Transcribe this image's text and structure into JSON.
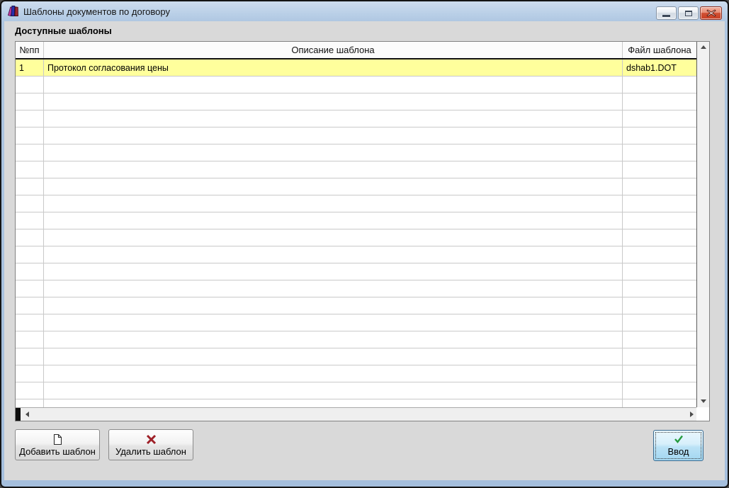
{
  "window": {
    "title": "Шаблоны документов по договору",
    "icons": {
      "app": "books-icon",
      "minimize": "minimize-icon",
      "maximize": "maximize-icon",
      "close": "close-icon"
    }
  },
  "section": {
    "label": "Доступные шаблоны"
  },
  "table": {
    "columns": [
      {
        "key": "num",
        "label": "№пп"
      },
      {
        "key": "description",
        "label": "Описание шаблона"
      },
      {
        "key": "file",
        "label": "Файл шаблона"
      }
    ],
    "rows": [
      {
        "num": "1",
        "description": "Протокол согласования цены",
        "file": "dshab1.DOT",
        "selected": true
      }
    ],
    "empty_row_count": 20,
    "selected_row_color": "#ffff9c"
  },
  "buttons": {
    "add": {
      "label": "Добавить шаблон",
      "icon": "new-document-icon"
    },
    "remove": {
      "label": "Удалить шаблон",
      "icon": "red-x-icon",
      "icon_color": "#9e2028"
    },
    "enter": {
      "label": "Ввод",
      "icon": "green-check-icon",
      "icon_color": "#259b3e"
    }
  },
  "colors": {
    "selected_row": "#ffff9c",
    "title_bar": "#b5cbe4",
    "client_bg": "#d9d9d9",
    "enter_button_border": "#3c6b90"
  }
}
